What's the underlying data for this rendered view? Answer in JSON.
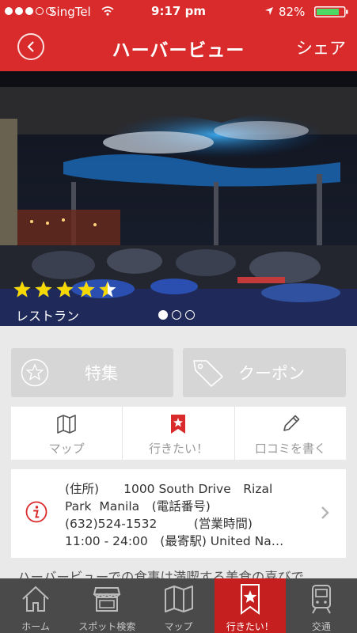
{
  "status_bar": {
    "carrier": "SingTel",
    "time": "9:17 pm",
    "battery": "82%",
    "icons": [
      "signal-dots-icon",
      "wifi-icon",
      "location-arrow-icon",
      "battery-icon"
    ]
  },
  "header": {
    "title": "ハーバービュー",
    "share_label": "シェア",
    "back_icon": "chevron-left-icon",
    "bar_color": "#d92b2b"
  },
  "hero": {
    "rating": 4.5,
    "rating_max": 5,
    "category": "レストラン",
    "page_count": 3,
    "current_page": 1
  },
  "features": {
    "special_label": "特集",
    "coupon_label": "クーポン"
  },
  "actions": [
    {
      "label": "マップ",
      "icon": "map-icon"
    },
    {
      "label": "行きたい！",
      "icon": "bookmark-star-icon"
    },
    {
      "label": "口コミを書く",
      "icon": "pencil-icon"
    }
  ],
  "info": {
    "lines": [
      "(住所)　　1000 South Drive　Rizal",
      "Park  Manila　(電話番号)",
      "(632)524-1532　　　(営業時間)",
      "11:00 - 24:00　(最寄駅) United Na…"
    ]
  },
  "description": "ハーバービューでの食事は満喫する美食の喜びで",
  "tabs": [
    {
      "label": "ホーム",
      "icon": "home-icon",
      "active": false
    },
    {
      "label": "スポット検索",
      "icon": "shop-icon",
      "active": false
    },
    {
      "label": "マップ",
      "icon": "map-icon",
      "active": false
    },
    {
      "label": "行きたい！",
      "icon": "bookmark-star-icon",
      "active": true
    },
    {
      "label": "交通",
      "icon": "train-icon",
      "active": false
    }
  ],
  "colors": {
    "accent": "#d92b2b",
    "tab_active": "#c61f1f",
    "star": "#f5d800"
  }
}
